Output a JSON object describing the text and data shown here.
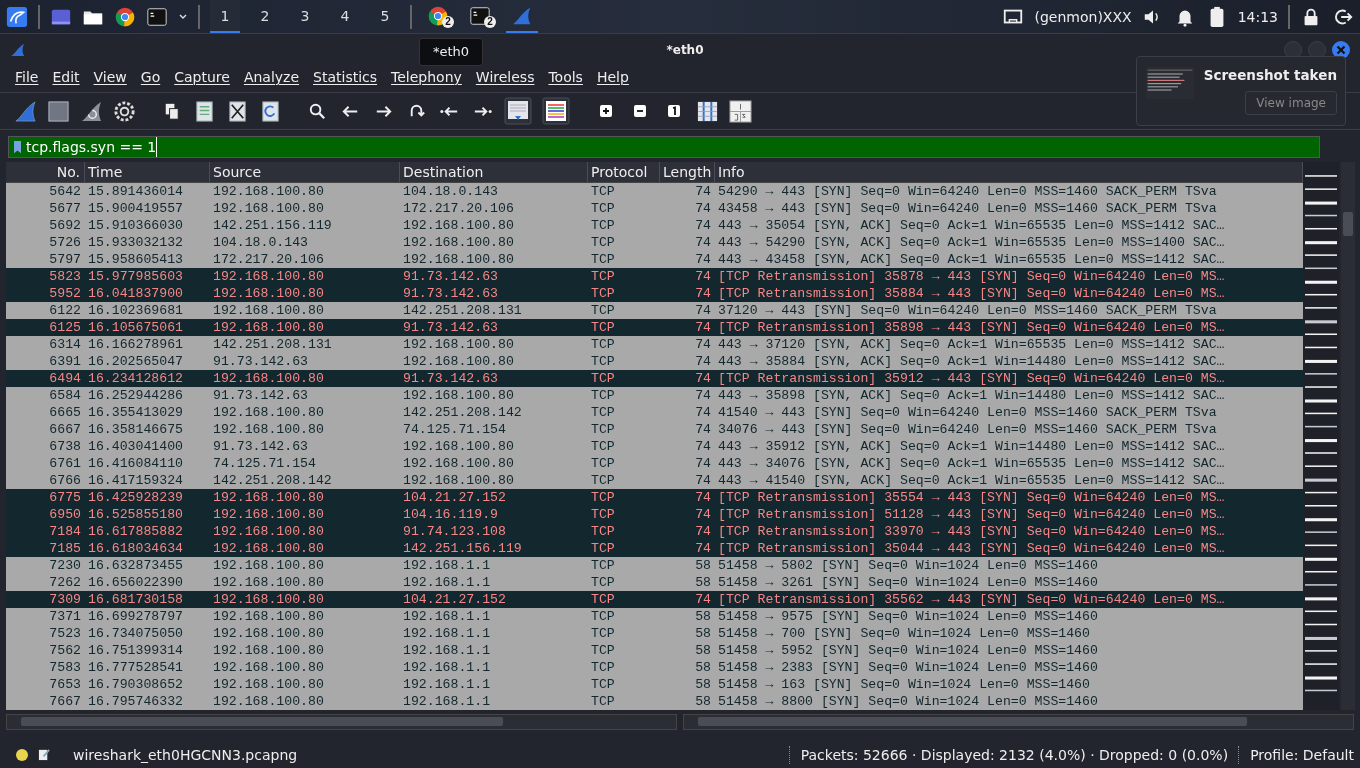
{
  "taskbar": {
    "workspaces": [
      {
        "label": "1",
        "selected": true
      },
      {
        "label": "2",
        "selected": false
      },
      {
        "label": "3",
        "selected": false
      },
      {
        "label": "4",
        "selected": false
      },
      {
        "label": "5",
        "selected": false
      }
    ],
    "running": [
      {
        "kind": "browser",
        "badge": "2",
        "selected": false
      },
      {
        "kind": "terminal",
        "badge": "2",
        "selected": false
      },
      {
        "kind": "wireshark",
        "selected": true
      }
    ],
    "plugin": "(genmon)XXX",
    "clock": "14:13"
  },
  "tooltip": "*eth0",
  "window": {
    "title": "*eth0"
  },
  "menu": [
    "File",
    "Edit",
    "View",
    "Go",
    "Capture",
    "Analyze",
    "Statistics",
    "Telephony",
    "Wireless",
    "Tools",
    "Help"
  ],
  "filter": {
    "value": "tcp.flags.syn == 1"
  },
  "notification": {
    "title": "Screenshot taken",
    "button": "View image"
  },
  "table": {
    "columns": [
      "No.",
      "Time",
      "Source",
      "Destination",
      "Protocol",
      "Length",
      "Info"
    ],
    "rows": [
      {
        "kind": "normal",
        "no": "5642",
        "time": "15.891436014",
        "source": "192.168.100.80",
        "destination": "104.18.0.143",
        "protocol": "TCP",
        "length": "74",
        "info": "54290 → 443 [SYN] Seq=0 Win=64240 Len=0 MSS=1460 SACK_PERM TSva"
      },
      {
        "kind": "normal",
        "no": "5677",
        "time": "15.900419557",
        "source": "192.168.100.80",
        "destination": "172.217.20.106",
        "protocol": "TCP",
        "length": "74",
        "info": "43458 → 443 [SYN] Seq=0 Win=64240 Len=0 MSS=1460 SACK_PERM TSva"
      },
      {
        "kind": "normal",
        "no": "5692",
        "time": "15.910366030",
        "source": "142.251.156.119",
        "destination": "192.168.100.80",
        "protocol": "TCP",
        "length": "74",
        "info": "443 → 35054 [SYN, ACK] Seq=0 Ack=1 Win=65535 Len=0 MSS=1412 SAC…"
      },
      {
        "kind": "normal",
        "no": "5726",
        "time": "15.933032132",
        "source": "104.18.0.143",
        "destination": "192.168.100.80",
        "protocol": "TCP",
        "length": "74",
        "info": "443 → 54290 [SYN, ACK] Seq=0 Ack=1 Win=65535 Len=0 MSS=1400 SAC…"
      },
      {
        "kind": "normal",
        "no": "5797",
        "time": "15.958605413",
        "source": "172.217.20.106",
        "destination": "192.168.100.80",
        "protocol": "TCP",
        "length": "74",
        "info": "443 → 43458 [SYN, ACK] Seq=0 Ack=1 Win=65535 Len=0 MSS=1412 SAC…"
      },
      {
        "kind": "retransmission",
        "no": "5823",
        "time": "15.977985603",
        "source": "192.168.100.80",
        "destination": "91.73.142.63",
        "protocol": "TCP",
        "length": "74",
        "info": "[TCP Retransmission] 35878 → 443 [SYN] Seq=0 Win=64240 Len=0 MS…"
      },
      {
        "kind": "retransmission",
        "no": "5952",
        "time": "16.041837900",
        "source": "192.168.100.80",
        "destination": "91.73.142.63",
        "protocol": "TCP",
        "length": "74",
        "info": "[TCP Retransmission] 35884 → 443 [SYN] Seq=0 Win=64240 Len=0 MS…"
      },
      {
        "kind": "normal",
        "no": "6122",
        "time": "16.102369681",
        "source": "192.168.100.80",
        "destination": "142.251.208.131",
        "protocol": "TCP",
        "length": "74",
        "info": "37120 → 443 [SYN] Seq=0 Win=64240 Len=0 MSS=1460 SACK_PERM TSva"
      },
      {
        "kind": "retransmission",
        "no": "6125",
        "time": "16.105675061",
        "source": "192.168.100.80",
        "destination": "91.73.142.63",
        "protocol": "TCP",
        "length": "74",
        "info": "[TCP Retransmission] 35898 → 443 [SYN] Seq=0 Win=64240 Len=0 MS…"
      },
      {
        "kind": "normal",
        "no": "6314",
        "time": "16.166278961",
        "source": "142.251.208.131",
        "destination": "192.168.100.80",
        "protocol": "TCP",
        "length": "74",
        "info": "443 → 37120 [SYN, ACK] Seq=0 Ack=1 Win=65535 Len=0 MSS=1412 SAC…"
      },
      {
        "kind": "normal",
        "no": "6391",
        "time": "16.202565047",
        "source": "91.73.142.63",
        "destination": "192.168.100.80",
        "protocol": "TCP",
        "length": "74",
        "info": "443 → 35884 [SYN, ACK] Seq=0 Ack=1 Win=14480 Len=0 MSS=1412 SAC…"
      },
      {
        "kind": "retransmission",
        "no": "6494",
        "time": "16.234128612",
        "source": "192.168.100.80",
        "destination": "91.73.142.63",
        "protocol": "TCP",
        "length": "74",
        "info": "[TCP Retransmission] 35912 → 443 [SYN] Seq=0 Win=64240 Len=0 MS…"
      },
      {
        "kind": "normal",
        "no": "6584",
        "time": "16.252944286",
        "source": "91.73.142.63",
        "destination": "192.168.100.80",
        "protocol": "TCP",
        "length": "74",
        "info": "443 → 35898 [SYN, ACK] Seq=0 Ack=1 Win=14480 Len=0 MSS=1412 SAC…"
      },
      {
        "kind": "normal",
        "no": "6665",
        "time": "16.355413029",
        "source": "192.168.100.80",
        "destination": "142.251.208.142",
        "protocol": "TCP",
        "length": "74",
        "info": "41540 → 443 [SYN] Seq=0 Win=64240 Len=0 MSS=1460 SACK_PERM TSva"
      },
      {
        "kind": "normal",
        "no": "6667",
        "time": "16.358146675",
        "source": "192.168.100.80",
        "destination": "74.125.71.154",
        "protocol": "TCP",
        "length": "74",
        "info": "34076 → 443 [SYN] Seq=0 Win=64240 Len=0 MSS=1460 SACK_PERM TSva"
      },
      {
        "kind": "normal",
        "no": "6738",
        "time": "16.403041400",
        "source": "91.73.142.63",
        "destination": "192.168.100.80",
        "protocol": "TCP",
        "length": "74",
        "info": "443 → 35912 [SYN, ACK] Seq=0 Ack=1 Win=14480 Len=0 MSS=1412 SAC…"
      },
      {
        "kind": "normal",
        "no": "6761",
        "time": "16.416084110",
        "source": "74.125.71.154",
        "destination": "192.168.100.80",
        "protocol": "TCP",
        "length": "74",
        "info": "443 → 34076 [SYN, ACK] Seq=0 Ack=1 Win=65535 Len=0 MSS=1412 SAC…"
      },
      {
        "kind": "normal",
        "no": "6766",
        "time": "16.417159324",
        "source": "142.251.208.142",
        "destination": "192.168.100.80",
        "protocol": "TCP",
        "length": "74",
        "info": "443 → 41540 [SYN, ACK] Seq=0 Ack=1 Win=65535 Len=0 MSS=1412 SAC…"
      },
      {
        "kind": "retransmission",
        "no": "6775",
        "time": "16.425928239",
        "source": "192.168.100.80",
        "destination": "104.21.27.152",
        "protocol": "TCP",
        "length": "74",
        "info": "[TCP Retransmission] 35554 → 443 [SYN] Seq=0 Win=64240 Len=0 MS…"
      },
      {
        "kind": "retransmission",
        "no": "6950",
        "time": "16.525855180",
        "source": "192.168.100.80",
        "destination": "104.16.119.9",
        "protocol": "TCP",
        "length": "74",
        "info": "[TCP Retransmission] 51128 → 443 [SYN] Seq=0 Win=64240 Len=0 MS…"
      },
      {
        "kind": "retransmission",
        "no": "7184",
        "time": "16.617885882",
        "source": "192.168.100.80",
        "destination": "91.74.123.108",
        "protocol": "TCP",
        "length": "74",
        "info": "[TCP Retransmission] 33970 → 443 [SYN] Seq=0 Win=64240 Len=0 MS…"
      },
      {
        "kind": "retransmission",
        "no": "7185",
        "time": "16.618034634",
        "source": "192.168.100.80",
        "destination": "142.251.156.119",
        "protocol": "TCP",
        "length": "74",
        "info": "[TCP Retransmission] 35044 → 443 [SYN] Seq=0 Win=64240 Len=0 MS…"
      },
      {
        "kind": "normal",
        "no": "7230",
        "time": "16.632873455",
        "source": "192.168.100.80",
        "destination": "192.168.1.1",
        "protocol": "TCP",
        "length": "58",
        "info": "51458 → 5802 [SYN] Seq=0 Win=1024 Len=0 MSS=1460"
      },
      {
        "kind": "normal",
        "no": "7262",
        "time": "16.656022390",
        "source": "192.168.100.80",
        "destination": "192.168.1.1",
        "protocol": "TCP",
        "length": "58",
        "info": "51458 → 3261 [SYN] Seq=0 Win=1024 Len=0 MSS=1460"
      },
      {
        "kind": "retransmission",
        "no": "7309",
        "time": "16.681730158",
        "source": "192.168.100.80",
        "destination": "104.21.27.152",
        "protocol": "TCP",
        "length": "74",
        "info": "[TCP Retransmission] 35562 → 443 [SYN] Seq=0 Win=64240 Len=0 MS…"
      },
      {
        "kind": "normal",
        "no": "7371",
        "time": "16.699278797",
        "source": "192.168.100.80",
        "destination": "192.168.1.1",
        "protocol": "TCP",
        "length": "58",
        "info": "51458 → 9575 [SYN] Seq=0 Win=1024 Len=0 MSS=1460"
      },
      {
        "kind": "normal",
        "no": "7523",
        "time": "16.734075050",
        "source": "192.168.100.80",
        "destination": "192.168.1.1",
        "protocol": "TCP",
        "length": "58",
        "info": "51458 → 700 [SYN] Seq=0 Win=1024 Len=0 MSS=1460"
      },
      {
        "kind": "normal",
        "no": "7562",
        "time": "16.751399314",
        "source": "192.168.100.80",
        "destination": "192.168.1.1",
        "protocol": "TCP",
        "length": "58",
        "info": "51458 → 5952 [SYN] Seq=0 Win=1024 Len=0 MSS=1460"
      },
      {
        "kind": "normal",
        "no": "7583",
        "time": "16.777528541",
        "source": "192.168.100.80",
        "destination": "192.168.1.1",
        "protocol": "TCP",
        "length": "58",
        "info": "51458 → 2383 [SYN] Seq=0 Win=1024 Len=0 MSS=1460"
      },
      {
        "kind": "normal",
        "no": "7653",
        "time": "16.790308652",
        "source": "192.168.100.80",
        "destination": "192.168.1.1",
        "protocol": "TCP",
        "length": "58",
        "info": "51458 → 163 [SYN] Seq=0 Win=1024 Len=0 MSS=1460"
      },
      {
        "kind": "normal",
        "no": "7667",
        "time": "16.795746332",
        "source": "192.168.100.80",
        "destination": "192.168.1.1",
        "protocol": "TCP",
        "length": "58",
        "info": "51458 → 8800 [SYN] Seq=0 Win=1024 Len=0 MSS=1460"
      }
    ]
  },
  "status_bar": {
    "file": "wireshark_eth0HGCNN3.pcapng",
    "stats": "Packets: 52666 · Displayed: 2132 (4.0%) · Dropped: 0 (0.0%)",
    "profile": "Profile: Default"
  }
}
